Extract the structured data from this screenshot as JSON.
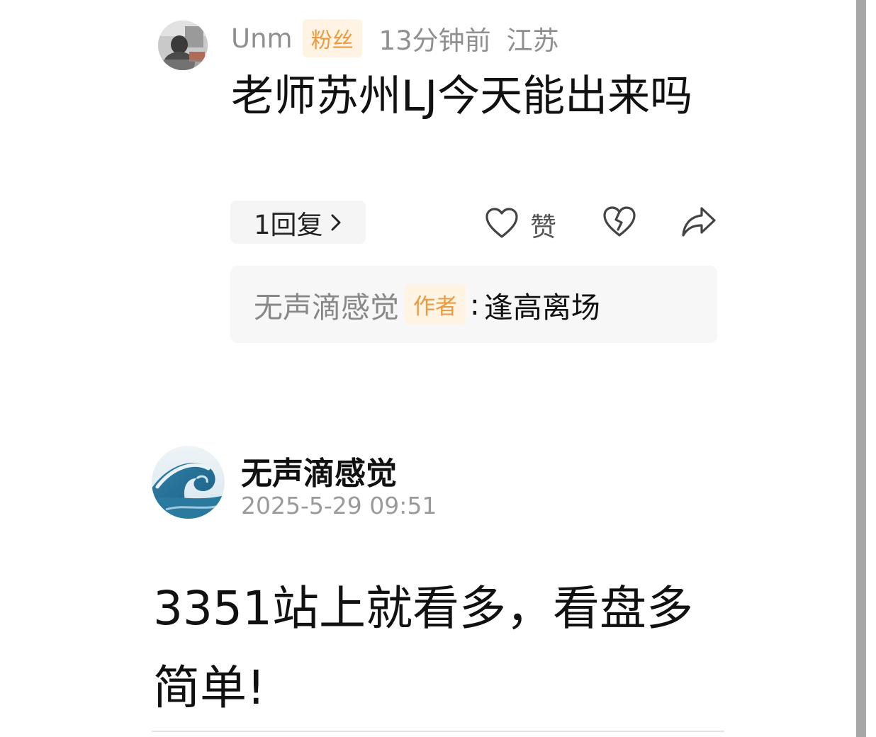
{
  "comment": {
    "user": "Unm",
    "badge": "粉丝",
    "time": "13分钟前",
    "location": "江苏",
    "text": "老师苏州LJ今天能出来吗",
    "reply_count_label": "1回复",
    "like_label": "赞",
    "author_reply": {
      "name": "无声滴感觉",
      "badge": "作者",
      "separator": ":",
      "text": "逢高离场"
    }
  },
  "post": {
    "author": "无声滴感觉",
    "date": "2025-5-29 09:51",
    "text": "3351站上就看多，看盘多简单!"
  },
  "icons": {
    "like": "heart-outline-icon",
    "dislike": "broken-heart-icon",
    "share": "share-arrow-icon",
    "reply_more": "chevron-right-icon"
  },
  "colors": {
    "badge_bg": "#fff3e4",
    "badge_text": "#eb9b3f",
    "meta_gray": "#8f8f8f",
    "panel_bg": "#f7f7f7"
  }
}
